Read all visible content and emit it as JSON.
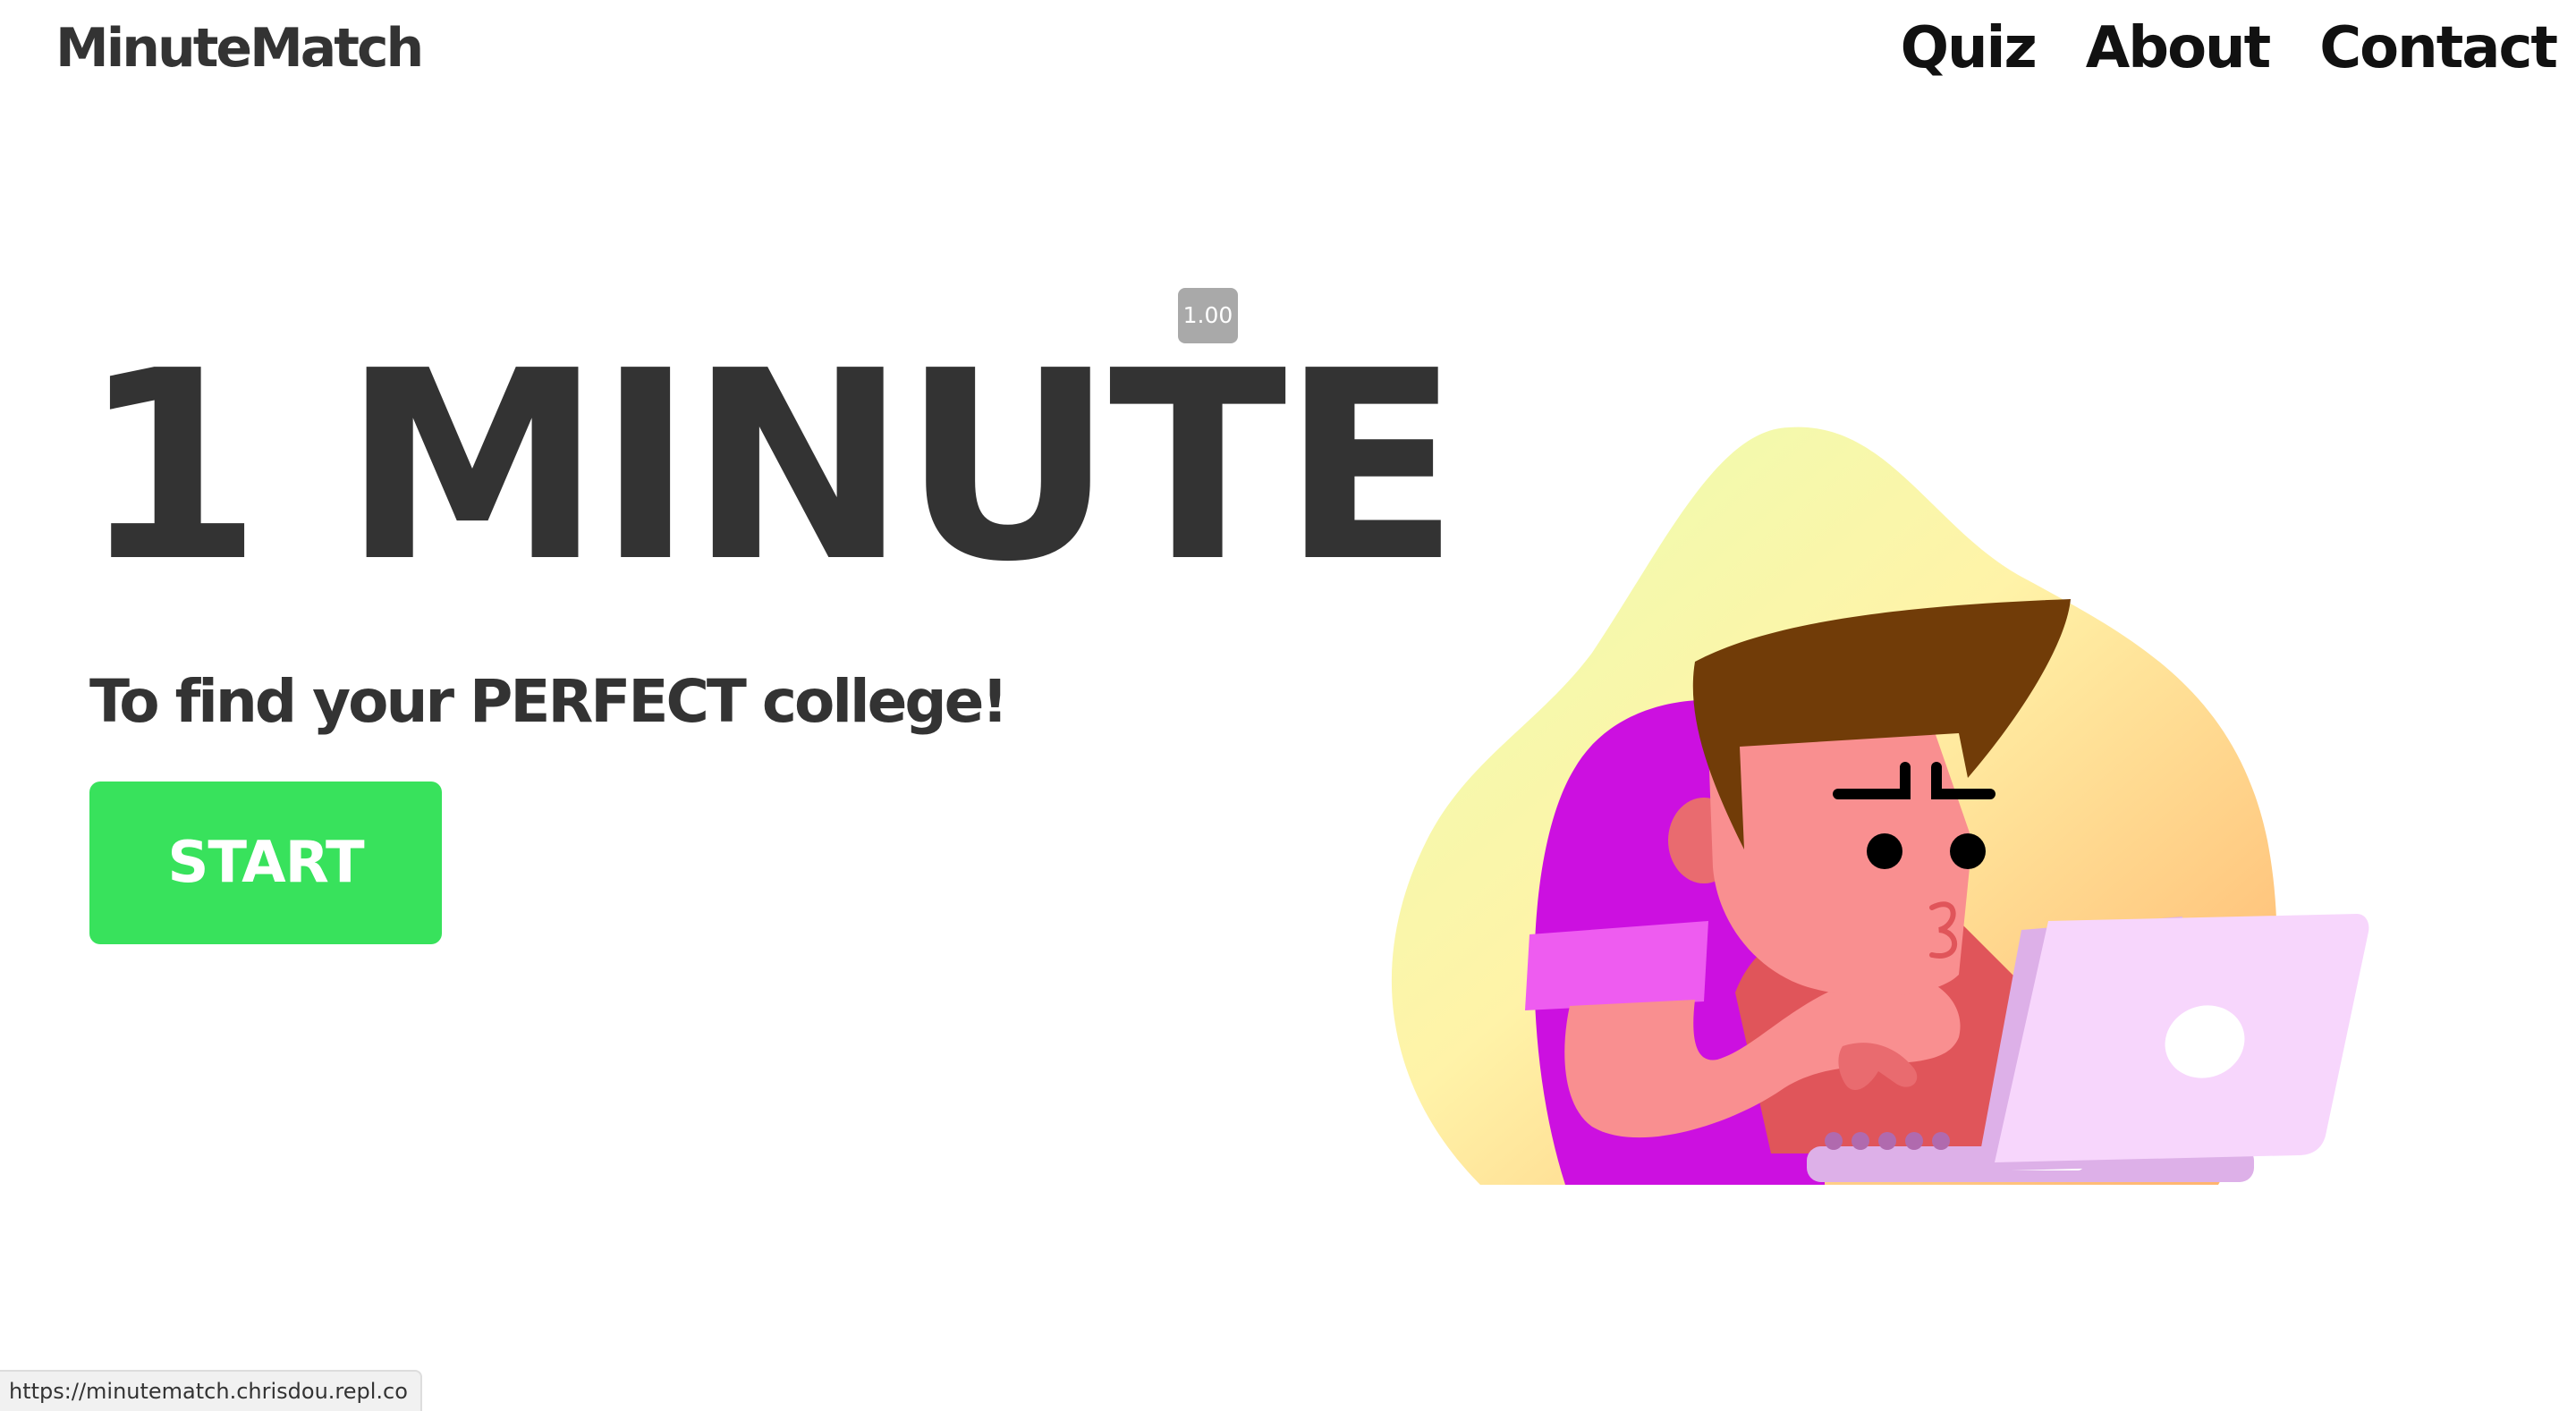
{
  "header": {
    "brand": "MinuteMatch",
    "nav": [
      "Quiz",
      "About",
      "Contact"
    ]
  },
  "hero": {
    "title": "1 MINUTE",
    "subtitle": "To find your PERFECT college!",
    "start_label": "START"
  },
  "zoom_badge": "1.00",
  "status_bar": {
    "url": "https://minutematch.chrisdou.repl.co"
  },
  "illustration": {
    "subject": "person-typing-on-laptop",
    "colors": {
      "blob_top": "#eaffb0",
      "blob_bottom": "#ffb06a",
      "chair": "#cc10e0",
      "sleeve": "#ee5cf0",
      "skin": "#f98f90",
      "skin_dark": "#e0555a",
      "hair": "#713c08",
      "laptop": "#f7d6fc",
      "laptop_base": "#ddb0e8"
    }
  },
  "colors": {
    "text_dark": "#333333",
    "start_button": "#38e25c",
    "badge": "#a9a9a9"
  }
}
